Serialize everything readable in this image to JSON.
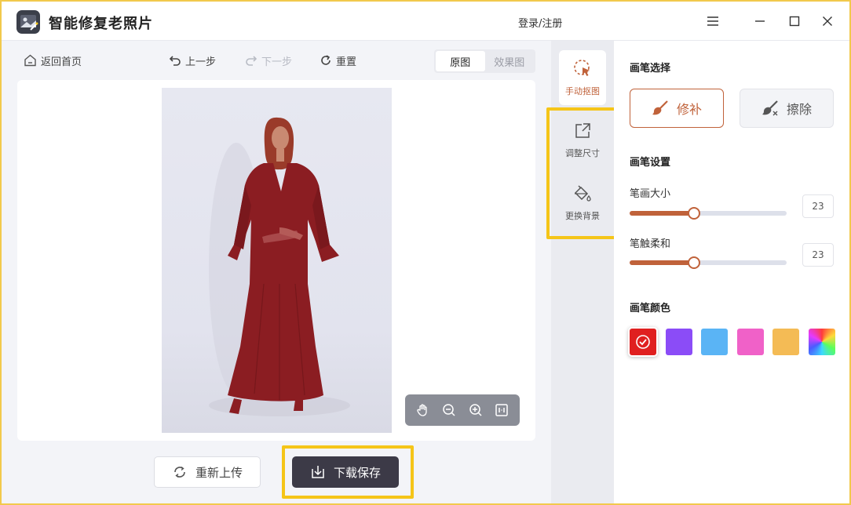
{
  "app": {
    "title": "智能修复老照片",
    "login": "登录/注册"
  },
  "toolbar": {
    "home": "返回首页",
    "undo": "上一步",
    "redo": "下一步",
    "reset": "重置",
    "view_original": "原图",
    "view_result": "效果图",
    "active_view": "原图"
  },
  "bottom": {
    "reupload": "重新上传",
    "download": "下载保存"
  },
  "tools": {
    "manual_cutout": "手动抠图",
    "resize": "调整尺寸",
    "change_bg": "更换背景"
  },
  "panel": {
    "brush_select_title": "画笔选择",
    "repair": "修补",
    "erase": "擦除",
    "brush_settings_title": "画笔设置",
    "brush_size_label": "笔画大小",
    "brush_size_value": "23",
    "brush_size_fraction": 0.41,
    "softness_label": "笔触柔和",
    "softness_value": "23",
    "softness_fraction": 0.41,
    "brush_color_title": "画笔颜色"
  },
  "colors": {
    "accent": "#c0623a",
    "highlight": "#f5c518",
    "swatches": [
      "#e02020",
      "#8b4cf7",
      "#5ab4f5",
      "#f061c8",
      "#f4bb55",
      "rainbow"
    ],
    "selected_swatch": 0
  }
}
